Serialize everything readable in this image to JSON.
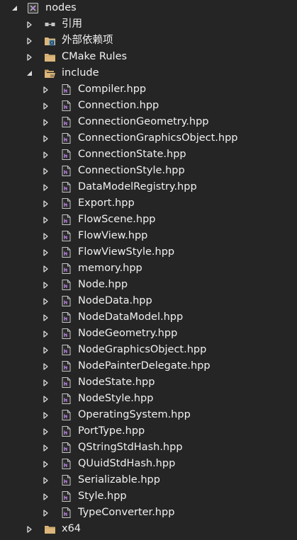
{
  "colors": {
    "background": "#252526",
    "text": "#f1f1f1",
    "expander": "#dcdcdc",
    "folder": "#dcb67a",
    "header_accent": "#b180d7"
  },
  "tree": {
    "project": {
      "label": "nodes",
      "expanded": true,
      "icon": "project-icon"
    },
    "children": [
      {
        "label": "引用",
        "icon": "references-icon",
        "expanded": false
      },
      {
        "label": "外部依赖项",
        "icon": "external-dependencies-icon",
        "expanded": false
      },
      {
        "label": "CMake Rules",
        "icon": "folder-icon",
        "expanded": false
      },
      {
        "label": "include",
        "icon": "folder-open-icon",
        "expanded": true,
        "files": [
          "Compiler.hpp",
          "Connection.hpp",
          "ConnectionGeometry.hpp",
          "ConnectionGraphicsObject.hpp",
          "ConnectionState.hpp",
          "ConnectionStyle.hpp",
          "DataModelRegistry.hpp",
          "Export.hpp",
          "FlowScene.hpp",
          "FlowView.hpp",
          "FlowViewStyle.hpp",
          "memory.hpp",
          "Node.hpp",
          "NodeData.hpp",
          "NodeDataModel.hpp",
          "NodeGeometry.hpp",
          "NodeGraphicsObject.hpp",
          "NodePainterDelegate.hpp",
          "NodeState.hpp",
          "NodeStyle.hpp",
          "OperatingSystem.hpp",
          "PortType.hpp",
          "QStringStdHash.hpp",
          "QUuidStdHash.hpp",
          "Serializable.hpp",
          "Style.hpp",
          "TypeConverter.hpp"
        ]
      },
      {
        "label": "x64",
        "icon": "folder-icon",
        "expanded": false
      }
    ]
  }
}
